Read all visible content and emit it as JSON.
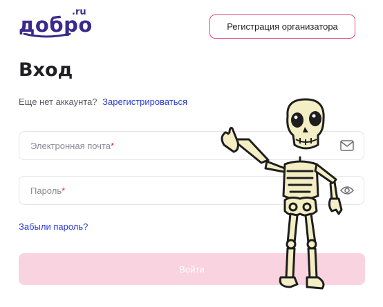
{
  "logo": {
    "word": "добро",
    "domain": ".ru"
  },
  "header": {
    "organizer_button": "Регистрация организатора"
  },
  "login": {
    "title": "Вход",
    "no_account_text": "Еще нет аккаунта?",
    "register_link": "Зарегистрироваться",
    "email_placeholder": "Электронная почта",
    "password_placeholder": "Пароль",
    "required_mark": "*",
    "forgot_link": "Забыли пароль?",
    "submit_label": "Войти"
  },
  "colors": {
    "brand": "#3b2a8c",
    "accent": "#e23f7b",
    "link": "#2b3bd3",
    "button_disabled": "#f9d3df"
  },
  "icons": [
    "mail-icon",
    "eye-icon"
  ]
}
